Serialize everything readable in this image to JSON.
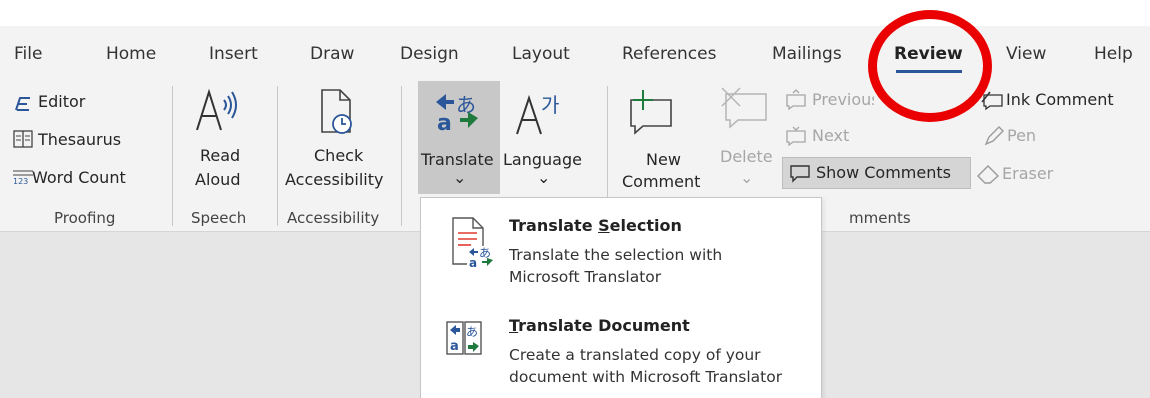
{
  "tabs": [
    "File",
    "Home",
    "Insert",
    "Draw",
    "Design",
    "Layout",
    "References",
    "Mailings",
    "Review",
    "View",
    "Help"
  ],
  "proofing": {
    "editor": "Editor",
    "thesaurus": "Thesaurus",
    "word_count": "Word Count",
    "group": "Proofing"
  },
  "speech": {
    "read": "Read",
    "aloud": "Aloud",
    "group": "Speech"
  },
  "accessibility": {
    "check": "Check",
    "accessibility": "Accessibility",
    "group": "Accessibility"
  },
  "language": {
    "translate": "Translate",
    "language": "Language",
    "caret": "⌄"
  },
  "comments": {
    "new": "New",
    "comment": "Comment",
    "delete": "Delete",
    "previous": "Previous",
    "next": "Next",
    "show_comments": "Show Comments",
    "group_visible": "mments"
  },
  "ink": {
    "ink_comment": "Ink Comment",
    "pen": "Pen",
    "eraser": "Eraser"
  },
  "dropdown": {
    "item1_title_pre": "Translate ",
    "item1_title_access": "S",
    "item1_title_post": "election",
    "item1_line1": "Translate the selection with",
    "item1_line2": "Microsoft Translator",
    "item2_title_access": "T",
    "item2_title_post": "ranslate Document",
    "item2_line1": "Create a translated copy of your",
    "item2_line2": "document with Microsoft Translator"
  },
  "colors": {
    "ribbon_bg": "#f3f3f3",
    "accent": "#2b579a",
    "highlight": "#c8c8c8",
    "annotation": "#ea0000"
  }
}
